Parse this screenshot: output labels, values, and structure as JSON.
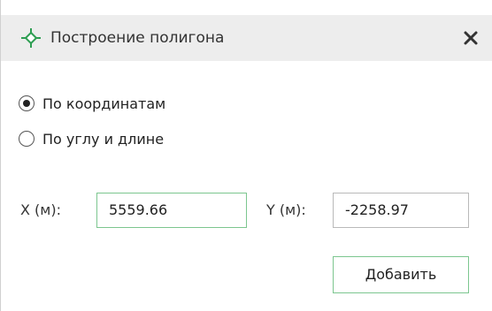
{
  "dialog": {
    "title": "Построение полигона",
    "title_icon": "polygon-crosshair-icon",
    "close_icon": "close-icon",
    "accent_color": "#2e9e52"
  },
  "mode": {
    "options": [
      {
        "label": "По координатам",
        "checked": true
      },
      {
        "label": "По углу и длине",
        "checked": false
      }
    ]
  },
  "coords": {
    "x_label": "X (м):",
    "x_value": "5559.66",
    "y_label": "Y (м):",
    "y_value": "-2258.97"
  },
  "actions": {
    "add_label": "Добавить"
  }
}
